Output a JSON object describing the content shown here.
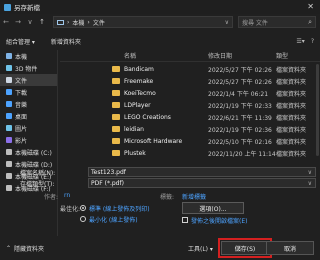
{
  "window": {
    "title": "另存新檔",
    "close_glyph": "✕"
  },
  "nav": {
    "back": "←",
    "forward": "→",
    "down": "∨",
    "up": "↑",
    "breadcrumb": [
      "本機",
      "文件"
    ],
    "sep": "›",
    "search_placeholder": "搜尋 文件"
  },
  "toolbar": {
    "organize": "組合管理 ▾",
    "new_folder": "新增資料夾"
  },
  "sidebar": {
    "items": [
      {
        "label": "本機",
        "icon": "computer-icon",
        "color": "#7fb3e6"
      },
      {
        "label": "3D 物件",
        "icon": "cube-icon",
        "color": "#6fc3e8"
      },
      {
        "label": "文件",
        "icon": "document-icon",
        "color": "#cfd8e3",
        "active": true
      },
      {
        "label": "下載",
        "icon": "download-icon",
        "color": "#4da3ff"
      },
      {
        "label": "音樂",
        "icon": "music-icon",
        "color": "#4da3ff"
      },
      {
        "label": "桌面",
        "icon": "desktop-icon",
        "color": "#4da3ff"
      },
      {
        "label": "圖片",
        "icon": "picture-icon",
        "color": "#6fc3e8"
      },
      {
        "label": "影片",
        "icon": "video-icon",
        "color": "#8b6fe8"
      },
      {
        "label": "本機磁碟 (C:)",
        "icon": "drive-icon",
        "color": "#bdbdbd"
      },
      {
        "label": "本機磁碟 (D:)",
        "icon": "drive-icon",
        "color": "#bdbdbd"
      },
      {
        "label": "本機磁碟 (E:)",
        "icon": "drive-icon",
        "color": "#bdbdbd"
      },
      {
        "label": "本機磁碟 (F:)",
        "icon": "drive-icon",
        "color": "#bdbdbd"
      }
    ]
  },
  "filelist": {
    "columns": {
      "name": "名稱",
      "date": "修改日期",
      "type": "類型"
    },
    "rows": [
      {
        "name": "Bandicam",
        "date": "2022/5/27 下午 02:26",
        "type": "檔案資料夾"
      },
      {
        "name": "Freemake",
        "date": "2022/5/27 下午 02:26",
        "type": "檔案資料夾"
      },
      {
        "name": "KoeiTecmo",
        "date": "2022/1/4 下午 06:21",
        "type": "檔案資料夾"
      },
      {
        "name": "LDPlayer",
        "date": "2022/1/19 下午 02:33",
        "type": "檔案資料夾"
      },
      {
        "name": "LEGO Creations",
        "date": "2022/6/21 下午 11:39",
        "type": "檔案資料夾"
      },
      {
        "name": "leidian",
        "date": "2022/1/19 下午 02:36",
        "type": "檔案資料夾"
      },
      {
        "name": "Microsoft Hardware",
        "date": "2022/5/10 下午 02:16",
        "type": "檔案資料夾"
      },
      {
        "name": "Plustek",
        "date": "2022/11/20 上午 11:14",
        "type": "檔案資料夾"
      }
    ]
  },
  "form": {
    "filename_label": "檔案名稱(N):",
    "filename_value": "Test123.pdf",
    "type_label": "存檔類型(T):",
    "type_value": "PDF (*.pdf)",
    "dropdown_glyph": "∨"
  },
  "meta": {
    "author_label": "作者:",
    "author_value": "rn",
    "tags_label": "標籤:",
    "tags_value": "新增標籤"
  },
  "options": {
    "label": "最佳化:",
    "radio1": "標準 (線上發佈及列印)",
    "radio2": "最小化 (線上發佈)",
    "options_button": "選項(O)...",
    "open_after": "發佈之後開啟檔案(E)"
  },
  "footer": {
    "hide_folders": "隱藏資料夾",
    "tools": "工具(L) ▾",
    "save": "儲存(S)",
    "cancel": "取消"
  }
}
